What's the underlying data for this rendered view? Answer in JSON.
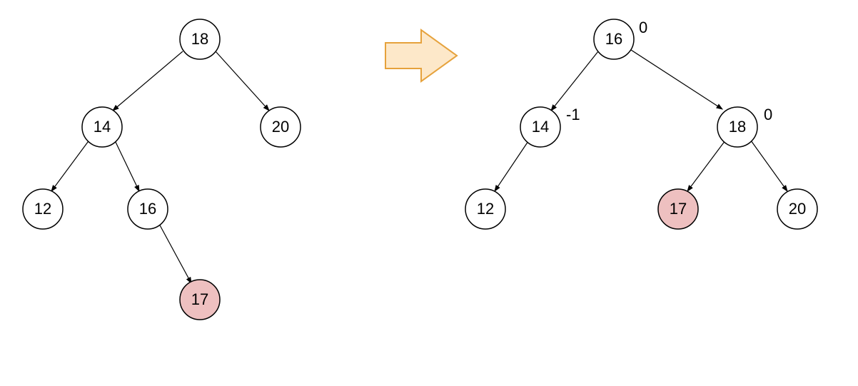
{
  "chart_data": {
    "type": "tree",
    "left_tree": {
      "nodes": {
        "root": {
          "value": 18
        },
        "l": {
          "value": 14
        },
        "r": {
          "value": 20
        },
        "ll": {
          "value": 12
        },
        "lr": {
          "value": 16
        },
        "lrr": {
          "value": 17,
          "highlight": true
        }
      },
      "edges": [
        [
          "root",
          "l"
        ],
        [
          "root",
          "r"
        ],
        [
          "l",
          "ll"
        ],
        [
          "l",
          "lr"
        ],
        [
          "lr",
          "lrr"
        ]
      ]
    },
    "right_tree": {
      "nodes": {
        "root": {
          "value": 16,
          "balance": 0
        },
        "l": {
          "value": 14,
          "balance": -1
        },
        "r": {
          "value": 18,
          "balance": 0
        },
        "ll": {
          "value": 12
        },
        "rl": {
          "value": 17,
          "highlight": true
        },
        "rr": {
          "value": 20
        }
      },
      "edges": [
        [
          "root",
          "l"
        ],
        [
          "root",
          "r"
        ],
        [
          "l",
          "ll"
        ],
        [
          "r",
          "rl"
        ],
        [
          "r",
          "rr"
        ]
      ]
    }
  },
  "colors": {
    "highlight_fill": "#eec0c0",
    "arrow_fill": "#fde8c9",
    "arrow_stroke": "#e6a23c",
    "node_stroke": "#000000"
  }
}
